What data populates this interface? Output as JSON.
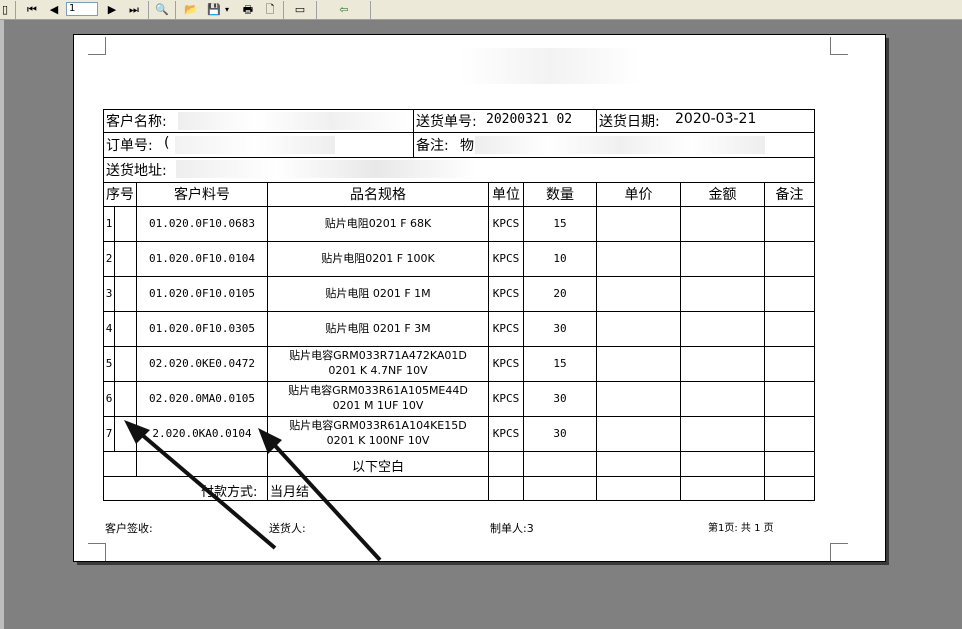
{
  "toolbar": {
    "page_number": "1",
    "buttons": [
      "first-page-icon",
      "prev-page-icon",
      "next-page-icon",
      "last-page-icon",
      "zoom-icon",
      "open-icon",
      "save-icon",
      "print-icon",
      "page-setup-icon",
      "fullscreen-icon",
      "exit-icon"
    ]
  },
  "doc": {
    "customer_label": "客户名称:",
    "customer_value_visible": "",
    "delivery_no_label": "送货单号:",
    "delivery_no_value": "20200321 02",
    "delivery_date_label": "送货日期:",
    "delivery_date_value": "2020-03-21",
    "order_label": "订单号:",
    "order_value": "(",
    "remark_label": "备注:",
    "remark_value": "物",
    "address_label": "送货地址:",
    "columns": [
      "序号",
      "客户料号",
      "品名规格",
      "单位",
      "数量",
      "单价",
      "金额",
      "备注"
    ],
    "rows": [
      {
        "no": "1",
        "part": "01.020.0F10.0683",
        "name": [
          "贴片电阻0201 F 68K"
        ],
        "unit": "KPCS",
        "qty": "15"
      },
      {
        "no": "2",
        "part": "01.020.0F10.0104",
        "name": [
          "贴片电阻0201 F 100K"
        ],
        "unit": "KPCS",
        "qty": "10"
      },
      {
        "no": "3",
        "part": "01.020.0F10.0105",
        "name": [
          "贴片电阻 0201 F 1M"
        ],
        "unit": "KPCS",
        "qty": "20"
      },
      {
        "no": "4",
        "part": "01.020.0F10.0305",
        "name": [
          "贴片电阻 0201 F 3M"
        ],
        "unit": "KPCS",
        "qty": "30"
      },
      {
        "no": "5",
        "part": "02.020.0KE0.0472",
        "name": [
          "贴片电容GRM033R71A472KA01D",
          "0201 K 4.7NF 10V"
        ],
        "unit": "KPCS",
        "qty": "15"
      },
      {
        "no": "6",
        "part": "02.020.0MA0.0105",
        "name": [
          "贴片电容GRM033R61A105ME44D",
          "0201 M 1UF 10V"
        ],
        "unit": "KPCS",
        "qty": "30"
      },
      {
        "no": "7",
        "part": "2.020.0KA0.0104",
        "name": [
          "贴片电容GRM033R61A104KE15D",
          "0201 K 100NF 10V"
        ],
        "unit": "KPCS",
        "qty": "30"
      }
    ],
    "blank_note": "以下空白",
    "payment_label": "付款方式:",
    "payment_value": "当月结",
    "footer": {
      "customer_sign": "客户签收:",
      "deliverer": "送货人:",
      "maker": "制单人:3",
      "page_info": "第1页: 共 1 页"
    }
  }
}
